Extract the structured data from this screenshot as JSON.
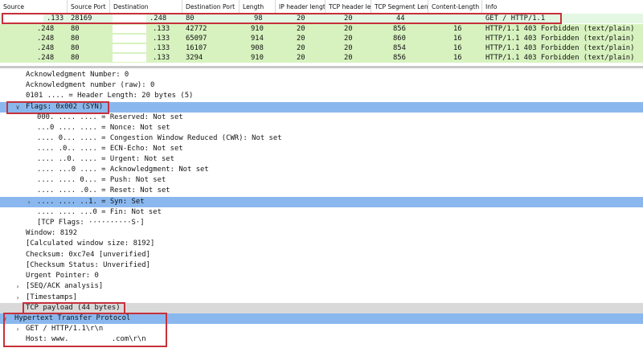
{
  "columns": [
    "Source",
    "Source Port",
    "Destination",
    "Destination Port",
    "Length",
    "IP header length",
    "TCP header len",
    "TCP Segment Len",
    "Content-Length",
    "Info"
  ],
  "packets": [
    {
      "src": ".133",
      "sport": "28169",
      "dst": ".248",
      "dport": "80",
      "len": "98",
      "iph": "20",
      "tcph": "20",
      "seg": "44",
      "clen": "",
      "info": "GET / HTTP/1.1"
    },
    {
      "src": ".248",
      "sport": "80",
      "dst": ".133",
      "dport": "42772",
      "len": "910",
      "iph": "20",
      "tcph": "20",
      "seg": "856",
      "clen": "16",
      "info": "HTTP/1.1 403 Forbidden  (text/plain)"
    },
    {
      "src": ".248",
      "sport": "80",
      "dst": ".133",
      "dport": "65097",
      "len": "914",
      "iph": "20",
      "tcph": "20",
      "seg": "860",
      "clen": "16",
      "info": "HTTP/1.1 403 Forbidden  (text/plain)"
    },
    {
      "src": ".248",
      "sport": "80",
      "dst": ".133",
      "dport": "16107",
      "len": "908",
      "iph": "20",
      "tcph": "20",
      "seg": "854",
      "clen": "16",
      "info": "HTTP/1.1 403 Forbidden  (text/plain)"
    },
    {
      "src": ".248",
      "sport": "80",
      "dst": ".133",
      "dport": "3294",
      "len": "910",
      "iph": "20",
      "tcph": "20",
      "seg": "856",
      "clen": "16",
      "info": "HTTP/1.1 403 Forbidden  (text/plain)"
    }
  ],
  "details": [
    "Acknowledgment Number: 0",
    "Acknowledgment number (raw): 0",
    "0101 .... = Header Length: 20 bytes (5)",
    "Flags: 0x002 (SYN)",
    "000. .... .... = Reserved: Not set",
    "...0 .... .... = Nonce: Not set",
    ".... 0... .... = Congestion Window Reduced (CWR): Not set",
    ".... .0.. .... = ECN-Echo: Not set",
    ".... ..0. .... = Urgent: Not set",
    ".... ...0 .... = Acknowledgment: Not set",
    ".... .... 0... = Push: Not set",
    ".... .... .0.. = Reset: Not set",
    ".... .... ..1. = Syn: Set",
    ".... .... ...0 = Fin: Not set",
    "[TCP Flags: ··········S·]",
    "Window: 8192",
    "[Calculated window size: 8192]",
    "Checksum: 0xc7e4 [unverified]",
    "[Checksum Status: Unverified]",
    "Urgent Pointer: 0",
    "[SEQ/ACK analysis]",
    "[Timestamps]",
    "TCP payload (44 bytes)",
    "Hypertext Transfer Protocol",
    "GET / HTTP/1.1\\r\\n",
    "Host: www.          .com\\r\\n"
  ],
  "icons": {
    "expanded": "chevron-down-icon",
    "collapsed": "chevron-right-icon"
  },
  "colors": {
    "selected": "#8ab8ee",
    "packet_green": "#d7f2bf",
    "highlight_box": "#c7303b",
    "payload_gray": "#d9d9d9"
  }
}
